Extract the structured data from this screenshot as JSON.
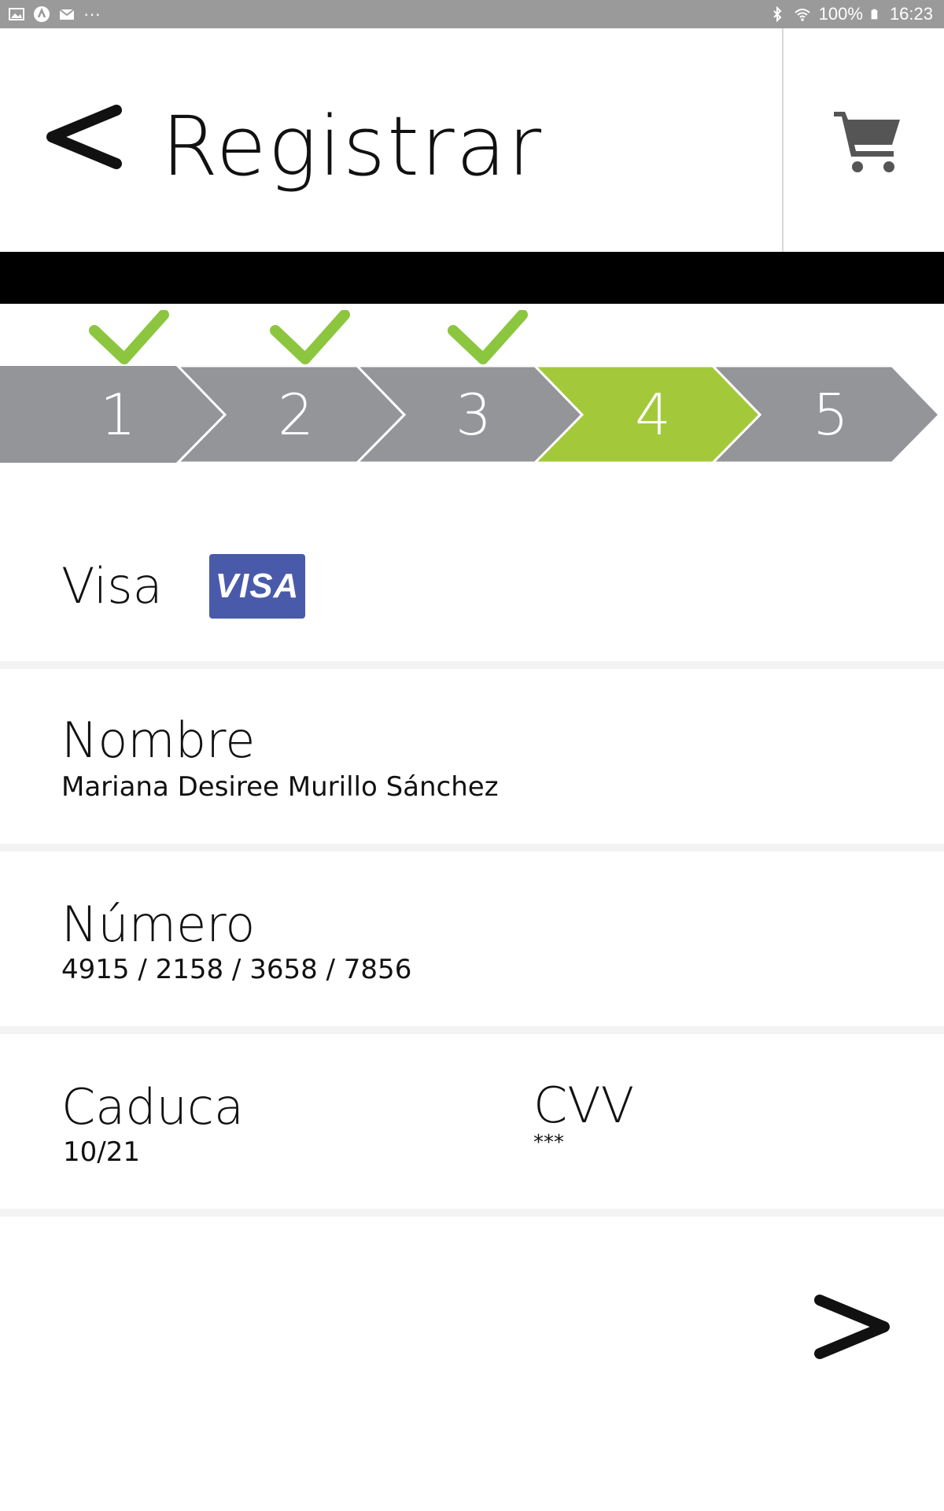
{
  "status_bar": {
    "left_icons": [
      "gallery-icon",
      "app-icon",
      "gmail-icon",
      "more-icon"
    ],
    "more_label": "···",
    "battery_percent": "100%",
    "time": "16:23",
    "right_icons": [
      "bluetooth-icon",
      "wifi-icon",
      "battery-icon"
    ]
  },
  "header": {
    "title": "Registrar",
    "back_icon": "chevron-left-icon",
    "cart_icon": "cart-icon"
  },
  "stepper": {
    "steps": [
      {
        "number": "1",
        "completed": true
      },
      {
        "number": "2",
        "completed": true
      },
      {
        "number": "3",
        "completed": true
      },
      {
        "number": "4",
        "active": true
      },
      {
        "number": "5",
        "completed": false
      }
    ],
    "colors": {
      "inactive": "#949599",
      "active": "#a3c93b",
      "check": "#8cc63f"
    }
  },
  "payment": {
    "card_type_label": "Visa",
    "card_logo_text": "VISA",
    "name_label": "Nombre",
    "name_value": "Mariana Desiree Murillo Sánchez",
    "number_label": "Número",
    "number_value": "4915 / 2158 / 3658 / 7856",
    "expiry_label": "Caduca",
    "expiry_value": "10/21",
    "cvv_label": "CVV",
    "cvv_value": "***"
  },
  "footer": {
    "next_icon": "chevron-right-icon"
  }
}
